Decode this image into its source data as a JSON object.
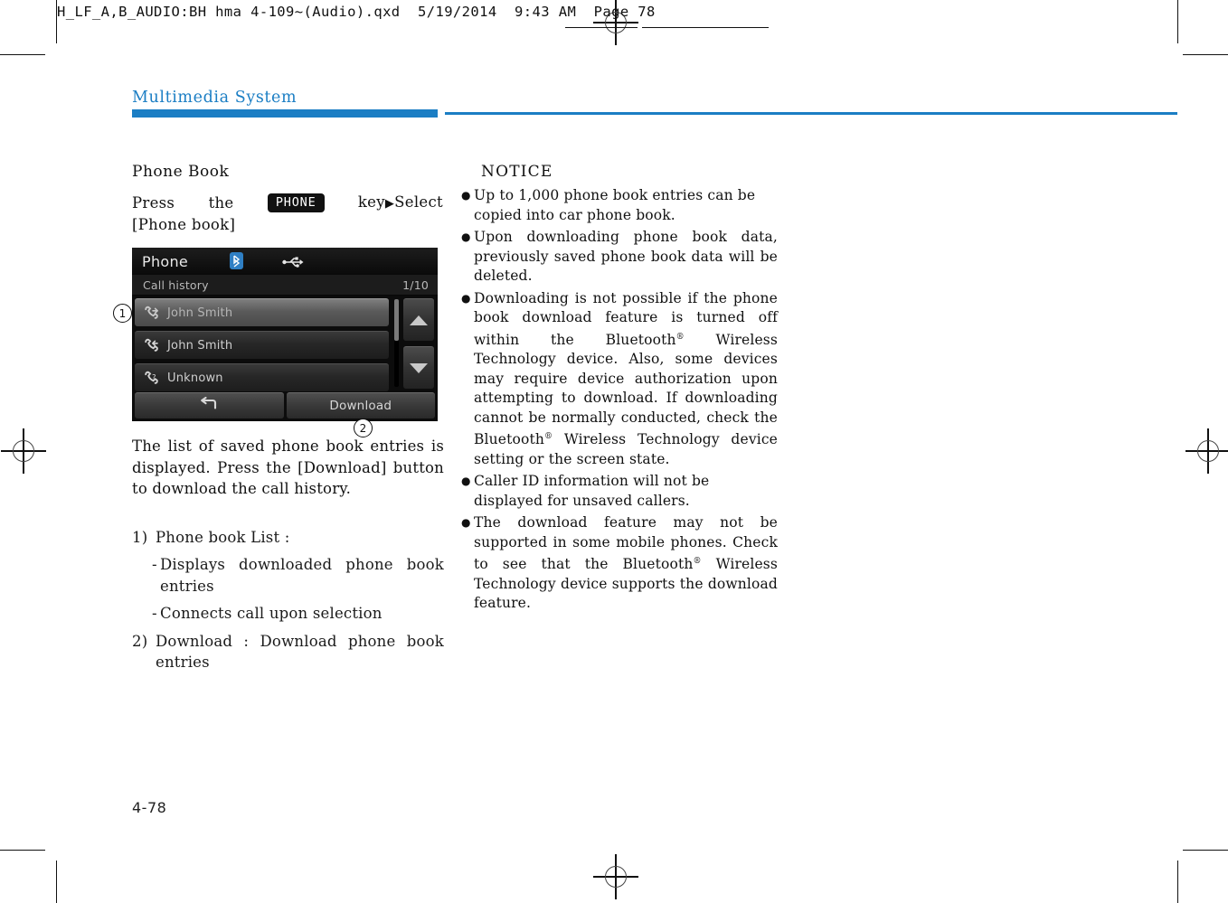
{
  "print_slug": "H_LF_A,B_AUDIO:BH hma 4-109~(Audio).qxd  5/19/2014  9:43 AM  Page 78",
  "section_title": "Multimedia System",
  "page_number": "4-78",
  "left_column": {
    "heading": "Phone Book",
    "press_prefix": "Press",
    "press_the": "the",
    "key_chip": "PHONE",
    "press_suffix": "key",
    "press_arrow": "▶",
    "press_select": "Select",
    "press_second_line": "[Phone book]",
    "paragraph": "The list of saved phone book entries is displayed. Press the [Download] button to download the call history.",
    "list": [
      {
        "num": "1)",
        "text": "Phone book List :",
        "sub": [
          "Displays downloaded phone book entries",
          "Connects call upon selection"
        ]
      },
      {
        "num": "2)",
        "text": "Download : Download phone book entries",
        "sub": []
      }
    ],
    "callouts": {
      "one": "①",
      "two": "②"
    }
  },
  "device_screenshot": {
    "title": "Phone",
    "bluetooth_icon": "bluetooth-icon",
    "usb_icon": "usb-icon",
    "subbar_label": "Call history",
    "page_indicator": "1/10",
    "rows": [
      {
        "label": "John Smith",
        "icon": "outgoing-call-icon",
        "selected": true
      },
      {
        "label": "John Smith",
        "icon": "incoming-call-icon",
        "selected": false
      },
      {
        "label": "Unknown",
        "icon": "unknown-call-icon",
        "selected": false
      }
    ],
    "scroll_up_icon": "triangle-up-icon",
    "scroll_down_icon": "triangle-down-icon",
    "back_button_icon": "back-arrow-icon",
    "download_button": "Download"
  },
  "notice": {
    "heading": "NOTICE",
    "bullets": [
      "Up to 1,000 phone book entries can be copied into car phone book.",
      "Upon downloading phone book data, previously saved phone book data will be deleted.",
      "Downloading is not possible if the phone book download feature is turned off within the Bluetooth® Wireless Technology device. Also, some devices may require device authorization upon attempting to download. If downloading cannot be normally conducted, check the Bluetooth® Wireless Technology device setting or the screen state.",
      "Caller ID information will not be displayed for unsaved callers.",
      "The download feature may not be supported in some mobile phones. Check to see that the Bluetooth® Wireless Technology device supports the download feature."
    ],
    "bullet_glyph": "●"
  },
  "colors": {
    "accent_blue": "#1b7ec4",
    "text_black": "#111111",
    "device_bg": "#0c0c0c"
  }
}
